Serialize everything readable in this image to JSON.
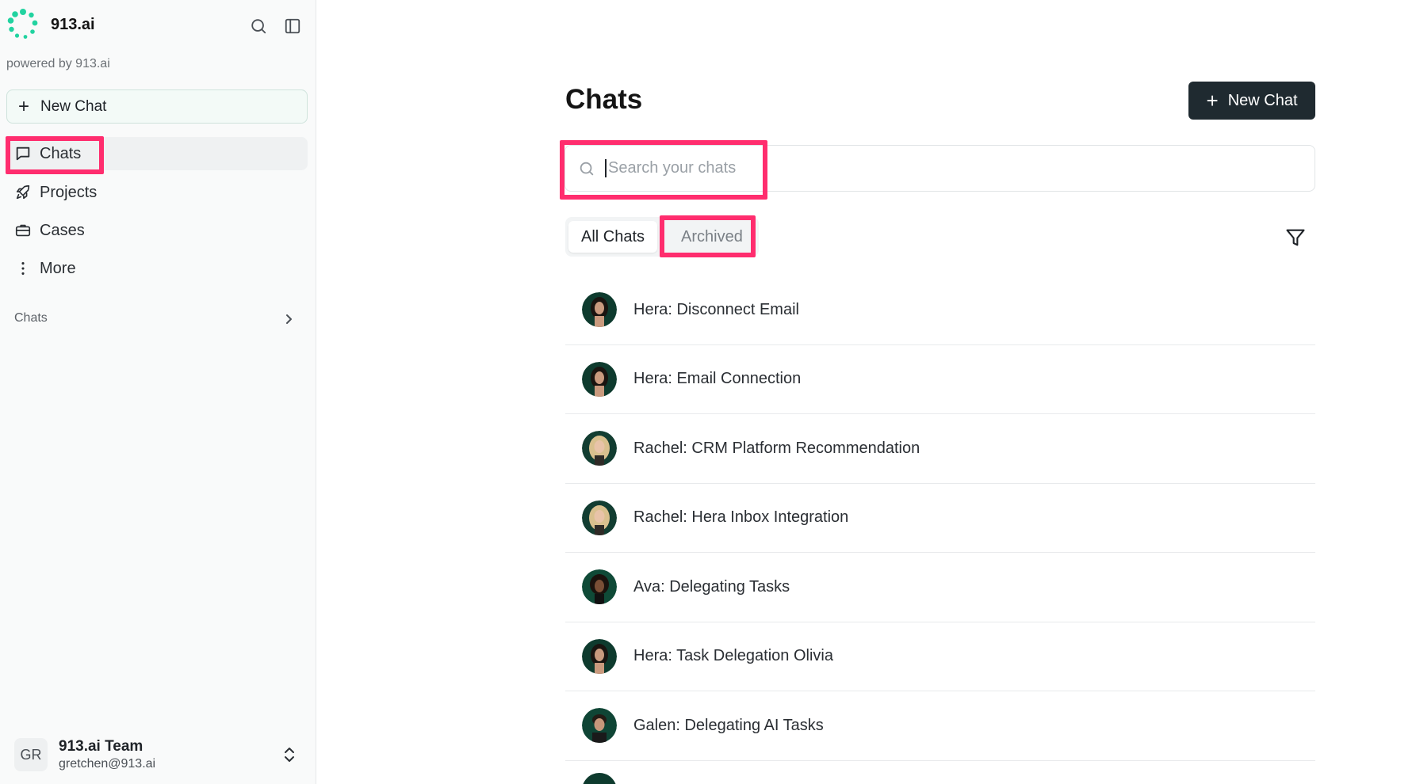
{
  "brand": {
    "name": "913.ai",
    "powered_by": "powered by 913.ai"
  },
  "sidebar": {
    "new_chat_label": "New Chat",
    "nav": [
      {
        "label": "Chats",
        "icon": "message-square-icon"
      },
      {
        "label": "Projects",
        "icon": "rocket-icon"
      },
      {
        "label": "Cases",
        "icon": "briefcase-icon"
      },
      {
        "label": "More",
        "icon": "more-vertical-icon"
      }
    ],
    "section_label": "Chats"
  },
  "user": {
    "initials": "GR",
    "name": "913.ai Team",
    "email": "gretchen@913.ai"
  },
  "main": {
    "title": "Chats",
    "new_chat_label": "New Chat",
    "search_placeholder": "Search your chats",
    "tabs": [
      {
        "label": "All Chats"
      },
      {
        "label": "Archived"
      }
    ],
    "chats": [
      {
        "title": "Hera: Disconnect Email",
        "avatar": "hera"
      },
      {
        "title": "Hera: Email Connection",
        "avatar": "hera"
      },
      {
        "title": "Rachel: CRM Platform Recommendation",
        "avatar": "rachel"
      },
      {
        "title": "Rachel: Hera Inbox Integration",
        "avatar": "rachel"
      },
      {
        "title": "Ava: Delegating Tasks",
        "avatar": "ava"
      },
      {
        "title": "Hera: Task Delegation Olivia",
        "avatar": "hera"
      },
      {
        "title": "Galen: Delegating AI Tasks",
        "avatar": "galen"
      }
    ]
  },
  "colors": {
    "highlight": "#ff2d6e",
    "brand_green": "#22d3a0",
    "primary_button": "#1f2a30"
  }
}
